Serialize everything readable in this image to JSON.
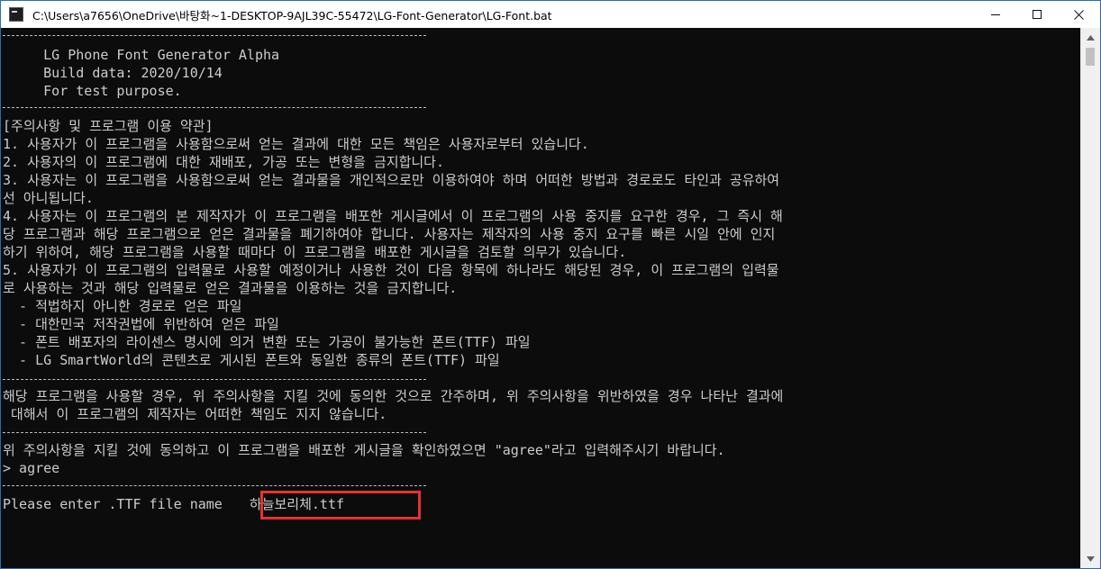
{
  "window": {
    "title": "C:\\Users\\a7656\\OneDrive\\바탕화~1-DESKTOP-9AJL39C-55472\\LG-Font-Generator\\LG-Font.bat",
    "icon": "console-app-icon",
    "buttons": {
      "minimize": "minimize-icon",
      "maximize": "maximize-icon",
      "close": "close-icon"
    }
  },
  "console": {
    "header": [
      "     LG Phone Font Generator Alpha",
      "     Build data: 2020/10/14",
      "     For test purpose."
    ],
    "terms": [
      "[주의사항 및 프로그램 이용 약관]",
      "1. 사용자가 이 프로그램을 사용함으로써 얻는 결과에 대한 모든 책임은 사용자로부터 있습니다.",
      "2. 사용자의 이 프로그램에 대한 재배포, 가공 또는 변형을 금지합니다.",
      "3. 사용자는 이 프로그램을 사용함으로써 얻는 결과물을 개인적으로만 이용하여야 하며 어떠한 방법과 경로로도 타인과 공유하여",
      "선 아니됩니다.",
      "4. 사용자는 이 프로그램의 본 제작자가 이 프로그램을 배포한 게시글에서 이 프로그램의 사용 중지를 요구한 경우, 그 즉시 해",
      "당 프로그램과 해당 프로그램으로 얻은 결과물을 폐기하여야 합니다. 사용자는 제작자의 사용 중지 요구를 빠른 시일 안에 인지",
      "하기 위하여, 해당 프로그램을 사용할 때마다 이 프로그램을 배포한 게시글을 검토할 의무가 있습니다.",
      "5. 사용자가 이 프로그램의 입력물로 사용할 예정이거나 사용한 것이 다음 항목에 하나라도 해당된 경우, 이 프로그램의 입력물",
      "로 사용하는 것과 해당 입력물로 얻은 결과물을 이용하는 것을 금지합니다.",
      "  - 적법하지 아니한 경로로 얻은 파일",
      "  - 대한민국 저작권법에 위반하여 얻은 파일",
      "  - 폰트 배포자의 라이센스 명시에 의거 변환 또는 가공이 불가능한 폰트(TTF) 파일",
      "",
      "  - LG SmartWorld의 콘텐츠로 게시된 폰트와 동일한 종류의 폰트(TTF) 파일"
    ],
    "agreement": [
      "해당 프로그램을 사용할 경우, 위 주의사항을 지킬 것에 동의한 것으로 간주하며, 위 주의사항을 위반하였을 경우 나타난 결과에",
      " 대해서 이 프로그램의 제작자는 어떠한 책임도 지지 않습니다."
    ],
    "prompt_line": "위 주의사항을 지킬 것에 동의하고 이 프로그램을 배포한 게시글을 확인하였으면 \"agree\"라고 입력해주시기 바랍니다.",
    "user_input": "> agree",
    "filename_prompt": "Please enter .TTF file name ",
    "filename_value": " 하늘보리체.ttf"
  },
  "colors": {
    "console_bg": "#0c0c0c",
    "console_text": "#cccccc",
    "highlight": "#e53232",
    "window_border": "#1f6fb7"
  }
}
